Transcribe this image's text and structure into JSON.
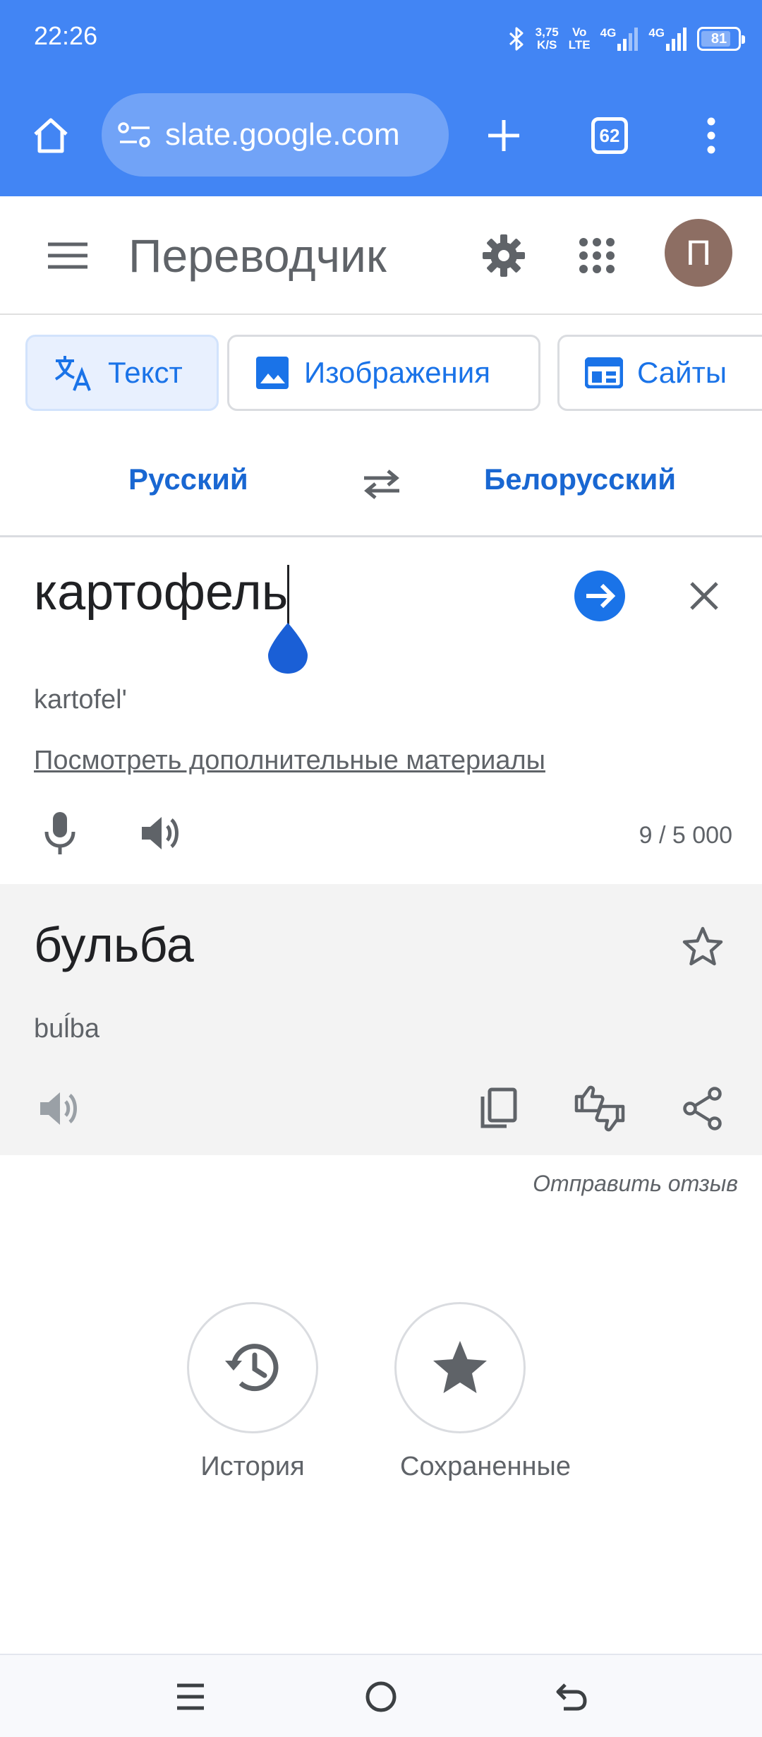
{
  "status_bar": {
    "time": "22:26",
    "net_speed_value": "3,75",
    "net_speed_unit": "K/S",
    "volte_top": "Vo",
    "volte_bottom": "LTE",
    "signal1_label": "4G",
    "signal2_label": "4G",
    "battery_level": "81",
    "battery_fraction": 0.81
  },
  "browser": {
    "url": "slate.google.com",
    "tab_count": "62"
  },
  "app": {
    "title": "Переводчик",
    "avatar_letter": "П"
  },
  "modes": [
    {
      "label": "Текст",
      "active": true
    },
    {
      "label": "Изображения",
      "active": false
    },
    {
      "label": "Сайты",
      "active": false
    }
  ],
  "languages": {
    "source": "Русский",
    "target": "Белорусский"
  },
  "source": {
    "text": "картофель",
    "transliteration": "kartofel'",
    "more_link": "Посмотреть дополнительные материалы",
    "char_count": "9 / 5 000"
  },
  "result": {
    "text": "бульба",
    "transliteration": "buĺba"
  },
  "feedback_link": "Отправить отзыв",
  "actions": {
    "history_label": "История",
    "saved_label": "Сохраненные"
  },
  "colors": {
    "chrome_blue": "#4285f4",
    "accent_blue": "#1a73e8",
    "avatar_brown": "#8d6e63",
    "result_bg": "#f3f3f3"
  }
}
